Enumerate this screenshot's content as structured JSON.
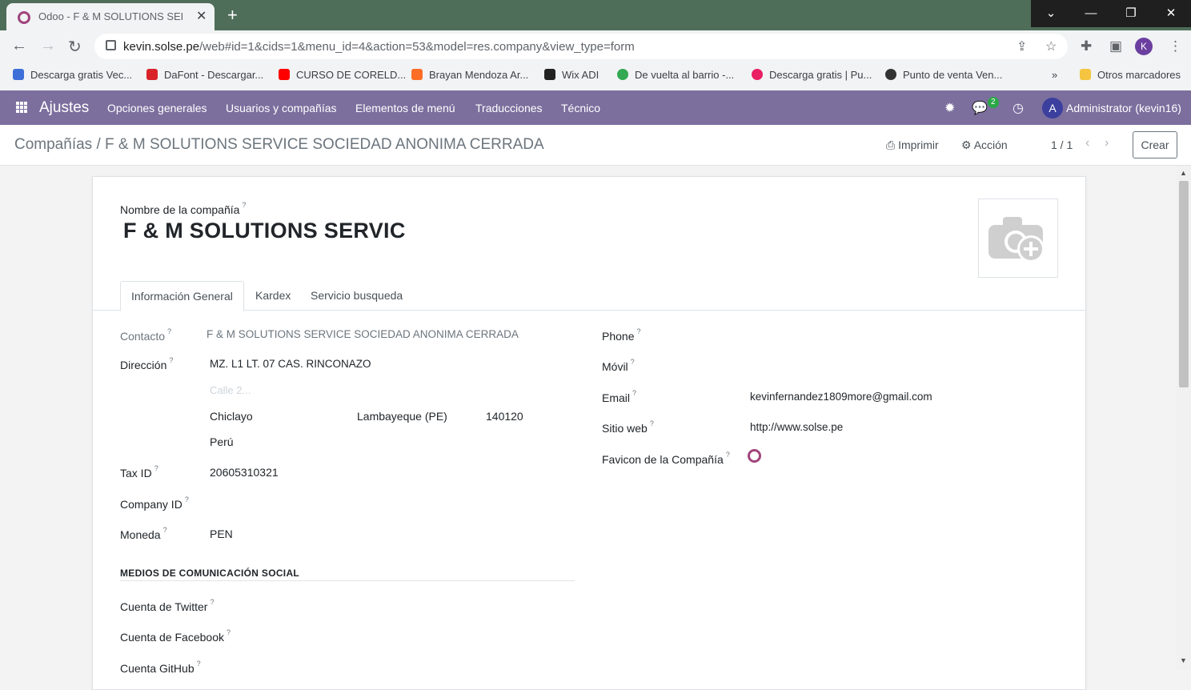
{
  "browser": {
    "tab_title": "Odoo - F & M SOLUTIONS SERVI",
    "url_host": "kevin.solse.pe",
    "url_path": "/web#id=1&cids=1&menu_id=4&action=53&model=res.company&view_type=form",
    "profile_initial": "K",
    "bookmarks": [
      {
        "label": "Descarga gratis Vec...",
        "color": "#3d6fd8"
      },
      {
        "label": "DaFont - Descargar...",
        "color": "#d9232a"
      },
      {
        "label": "CURSO DE CORELD...",
        "color": "#ff0000"
      },
      {
        "label": "Brayan Mendoza Ar...",
        "color": "#fc6d26"
      },
      {
        "label": "Wix ADI",
        "color": "#222222"
      },
      {
        "label": "De vuelta al barrio -...",
        "color": "#34a853"
      },
      {
        "label": "Descarga gratis | Pu...",
        "color": "#e91e63"
      },
      {
        "label": "Punto de venta Ven...",
        "color": "#333333"
      }
    ],
    "more_bookmarks": "»",
    "other_bookmarks": "Otros marcadores"
  },
  "navbar": {
    "brand": "Ajustes",
    "menus": [
      "Opciones generales",
      "Usuarios y compañías",
      "Elementos de menú",
      "Traducciones",
      "Técnico"
    ],
    "messages_badge": "2",
    "avatar_initial": "A",
    "user": "Administrator (kevin16)",
    "accent": "#7c6f9e"
  },
  "control_panel": {
    "breadcrumb_parent": "Compañías",
    "breadcrumb_sep": "/",
    "breadcrumb_current": "F & M SOLUTIONS SERVICE SOCIEDAD ANONIMA CERRADA",
    "print_label": "Imprimir",
    "action_label": "Acción",
    "pager": "1 / 1",
    "create_label": "Crear"
  },
  "form": {
    "company_name_label": "Nombre de la compañía",
    "company_name": "F & M SOLUTIONS SERVIC",
    "tabs": [
      "Información General",
      "Kardex",
      "Servicio busqueda"
    ],
    "left": {
      "contacto_label": "Contacto",
      "contacto_value": "F & M SOLUTIONS SERVICE SOCIEDAD ANONIMA CERRADA",
      "direccion_label": "Dirección",
      "street": "MZ. L1 LT. 07 CAS. RINCONAZO",
      "street2_placeholder": "Calle 2...",
      "city": "Chiclayo",
      "state": "Lambayeque (PE)",
      "zip": "140120",
      "country": "Perú",
      "taxid_label": "Tax ID",
      "taxid_value": "20605310321",
      "companyid_label": "Company ID",
      "moneda_label": "Moneda",
      "moneda_value": "PEN"
    },
    "right": {
      "phone_label": "Phone",
      "movil_label": "Móvil",
      "email_label": "Email",
      "email_value": "kevinfernandez1809more@gmail.com",
      "web_label": "Sitio web",
      "web_value": "http://www.solse.pe",
      "favicon_label": "Favicon de la Compañía"
    },
    "social_title": "MEDIOS DE COMUNICACIÓN SOCIAL",
    "twitter_label": "Cuenta de Twitter",
    "facebook_label": "Cuenta de Facebook",
    "github_label": "Cuenta GitHub",
    "help_mark": "?"
  }
}
